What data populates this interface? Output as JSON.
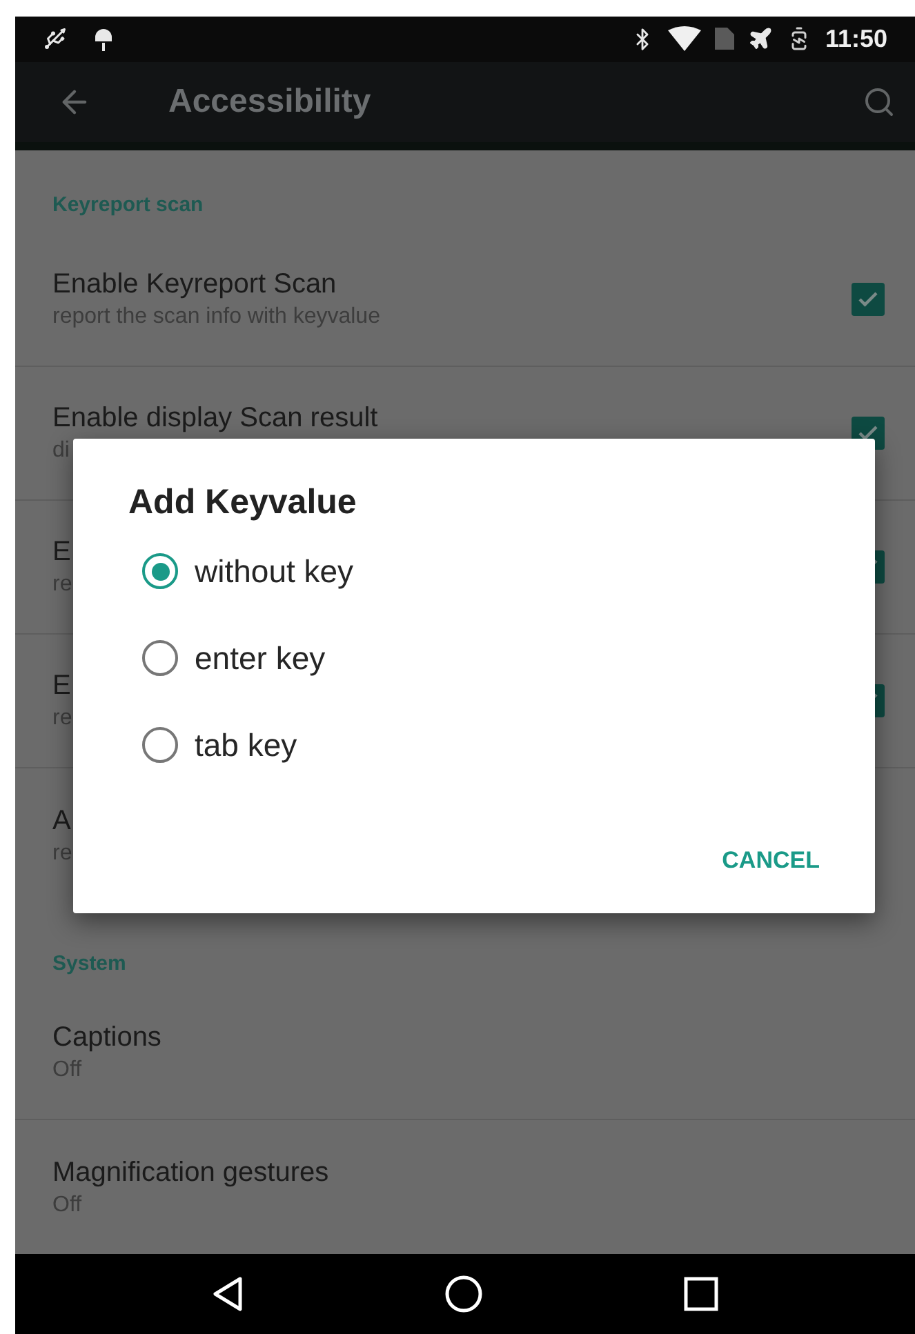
{
  "status_bar": {
    "time": "11:50"
  },
  "toolbar": {
    "title": "Accessibility"
  },
  "sections": [
    {
      "header": "Keyreport scan",
      "items": [
        {
          "title": "Enable Keyreport Scan",
          "subtitle": "report the scan info with keyvalue",
          "kind": "checkbox",
          "checked": true
        },
        {
          "title": "Enable display Scan result",
          "subtitle": "di",
          "kind": "checkbox",
          "checked": true
        },
        {
          "title": "E",
          "subtitle": "re",
          "kind": "checkbox",
          "checked": true
        },
        {
          "title": "E",
          "subtitle": "re",
          "kind": "checkbox",
          "checked": true
        },
        {
          "title": "A",
          "subtitle": "re",
          "kind": "plain"
        }
      ]
    },
    {
      "header": "System",
      "items": [
        {
          "title": "Captions",
          "subtitle": "Off",
          "kind": "plain"
        },
        {
          "title": "Magnification gestures",
          "subtitle": "Off",
          "kind": "plain"
        }
      ]
    }
  ],
  "dialog": {
    "title": "Add Keyvalue",
    "options": [
      {
        "label": "without key",
        "selected": true
      },
      {
        "label": "enter key",
        "selected": false
      },
      {
        "label": "tab key",
        "selected": false
      }
    ],
    "buttons": [
      "CANCEL"
    ]
  }
}
